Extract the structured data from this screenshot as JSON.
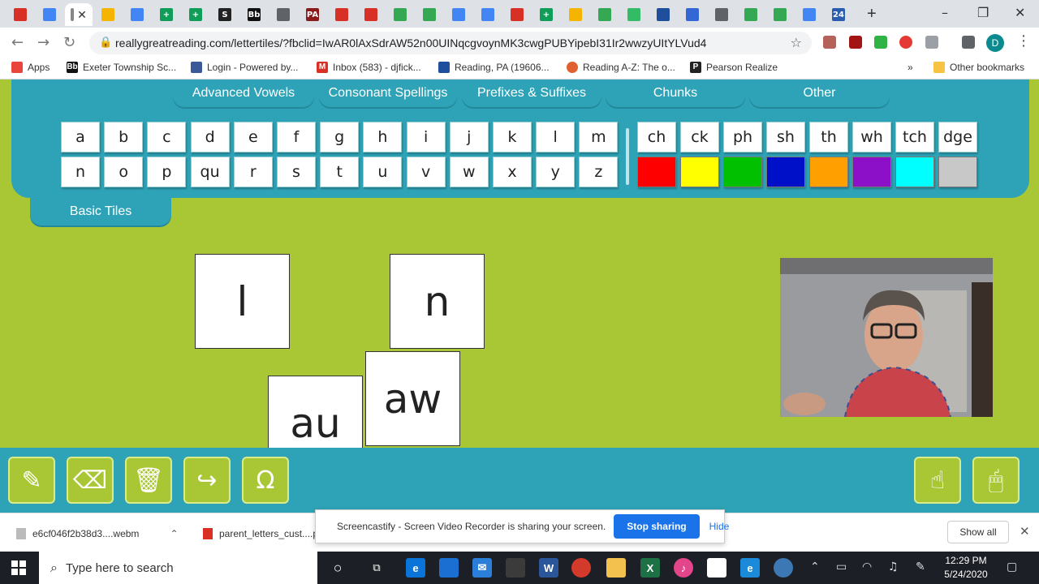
{
  "browser": {
    "url": "reallygreatreading.com/lettertiles/?fbclid=IwAR0lAxSdrAW52n00UINqcgvoynMK3cwgPUBYipebI31Ir2wwzyUItYLVud4",
    "profile_initial": "D",
    "tab_icons": [
      "gmail",
      "docs",
      "active",
      "slides",
      "docs",
      "sheets",
      "sheets",
      "s",
      "bb",
      "globe",
      "pa",
      "gmail",
      "gmail",
      "drive",
      "drive",
      "docs",
      "docs",
      "gmail",
      "sheets",
      "slides",
      "drive",
      "ext",
      "weather",
      "spinner",
      "globe",
      "drive",
      "drive",
      "docs",
      "24"
    ]
  },
  "bookmarks": {
    "items": [
      "Apps",
      "Exeter Township Sc...",
      "Login - Powered by...",
      "Inbox (583) - djfick...",
      "Reading, PA (19606...",
      "Reading A-Z: The o...",
      "Pearson Realize"
    ],
    "more": "»",
    "other": "Other bookmarks"
  },
  "categories": [
    "Advanced Vowels",
    "Consonant Spellings",
    "Prefixes & Suffixes",
    "Chunks",
    "Other"
  ],
  "letters_row1": [
    "a",
    "b",
    "c",
    "d",
    "e",
    "f",
    "g",
    "h",
    "i",
    "j",
    "k",
    "l",
    "m"
  ],
  "letters_row2": [
    "n",
    "o",
    "p",
    "qu",
    "r",
    "s",
    "t",
    "u",
    "v",
    "w",
    "x",
    "y",
    "z"
  ],
  "digraphs": [
    "ch",
    "ck",
    "ph",
    "sh",
    "th",
    "wh",
    "tch",
    "dge"
  ],
  "colors": [
    "#ff0000",
    "#ffff00",
    "#00c000",
    "#0010c8",
    "#ffa000",
    "#8c10c8",
    "#00ffff",
    "#c8c8c8"
  ],
  "basic_tab": "Basic Tiles",
  "board_tiles": [
    "l",
    "n",
    "au",
    "aw"
  ],
  "tools": [
    "pencil",
    "eraser",
    "trash",
    "redo",
    "magnet"
  ],
  "right_tools": [
    "touch",
    "mouse"
  ],
  "downloads": {
    "file1": "e6cf046f2b38d3....webm",
    "file2": "parent_letters_cust....pdf",
    "show_all": "Show all"
  },
  "share_bar": {
    "text": "Screencastify - Screen Video Recorder is sharing your screen.",
    "stop": "Stop sharing",
    "hide": "Hide"
  },
  "taskbar": {
    "search_placeholder": "Type here to search",
    "time": "12:29 PM",
    "date": "5/24/2020"
  }
}
